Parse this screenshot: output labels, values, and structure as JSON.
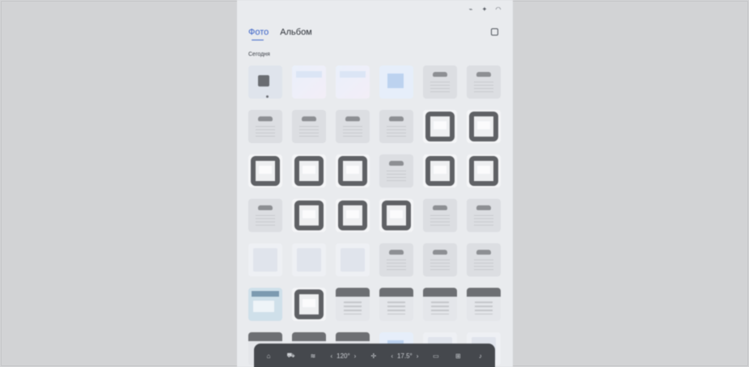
{
  "app": {
    "status_icons": [
      "signal-icon",
      "bluetooth-icon",
      "wifi-icon"
    ],
    "tabs": [
      {
        "label": "Фото",
        "active": true
      },
      {
        "label": "Альбом",
        "active": false
      }
    ],
    "section_label": "Сегодня",
    "thumbnails": [
      "t-first",
      "t-pastel",
      "t-pastel",
      "t-blue",
      "t-doc",
      "t-doc",
      "t-doc",
      "t-doc",
      "t-doc",
      "t-doc",
      "t-frame",
      "t-frame",
      "t-frame",
      "t-frame",
      "t-frame",
      "t-doc",
      "t-frame",
      "t-frame",
      "t-doc",
      "t-frame",
      "t-frame",
      "t-frame",
      "t-doc",
      "t-doc",
      "t-light",
      "t-light",
      "t-light",
      "t-doc",
      "t-doc",
      "t-doc",
      "t-shot",
      "t-frame",
      "t-panel",
      "t-panel",
      "t-panel",
      "t-panel",
      "t-panel",
      "t-panel",
      "t-panel",
      "t-blue",
      "t-light",
      "t-light"
    ]
  },
  "dock": {
    "left_temp": "120°",
    "right_temp": "17.5°",
    "left_chevron_open": "‹",
    "left_chevron_close": "›",
    "right_chevron_open": "‹",
    "right_chevron_close": "›"
  }
}
